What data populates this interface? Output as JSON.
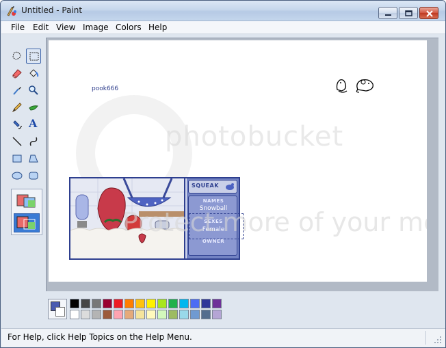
{
  "window": {
    "title": "Untitled - Paint"
  },
  "menubar": {
    "items": [
      "File",
      "Edit",
      "View",
      "Image",
      "Colors",
      "Help"
    ]
  },
  "toolbox": {
    "tools": [
      {
        "name": "free-form-select-icon"
      },
      {
        "name": "select-icon",
        "selected": true
      },
      {
        "name": "eraser-icon"
      },
      {
        "name": "fill-bucket-icon"
      },
      {
        "name": "pick-color-icon"
      },
      {
        "name": "magnifier-icon"
      },
      {
        "name": "pencil-icon"
      },
      {
        "name": "brush-icon"
      },
      {
        "name": "airbrush-icon"
      },
      {
        "name": "text-icon"
      },
      {
        "name": "line-icon"
      },
      {
        "name": "curve-icon"
      },
      {
        "name": "rectangle-icon"
      },
      {
        "name": "polygon-icon"
      },
      {
        "name": "ellipse-icon"
      },
      {
        "name": "rounded-rectangle-icon"
      }
    ],
    "text_tool_glyph": "A"
  },
  "canvas": {
    "username_text": "pook666",
    "watermark_text": "photobucket",
    "watermark_text2": "Protect more of your memories for less!",
    "petcard": {
      "header": "SQUEAK",
      "name_label": "NAMES",
      "name_value": "Snowball",
      "sex_label": "SEXES",
      "sex_value": "Female",
      "owner_label": "OWNER"
    }
  },
  "palette": {
    "foreground": "#4a5bb0",
    "background": "#ffffff",
    "row1": [
      "#000000",
      "#464646",
      "#787878",
      "#990030",
      "#ed1c24",
      "#ff7e00",
      "#ffc20e",
      "#fff200",
      "#a8e61d",
      "#22b14c",
      "#00b7ef",
      "#4d6df3",
      "#2f3699",
      "#6f3198"
    ],
    "row2": [
      "#ffffff",
      "#dcdcdc",
      "#b4b4b4",
      "#9c5a3c",
      "#ffa3b1",
      "#e5aa7a",
      "#f5e49c",
      "#fff9bd",
      "#d3f9bc",
      "#9dbb61",
      "#99d9ea",
      "#709ad1",
      "#546d8e",
      "#b5a5d5"
    ]
  },
  "statusbar": {
    "help_text": "For Help, click Help Topics on the Help Menu."
  }
}
